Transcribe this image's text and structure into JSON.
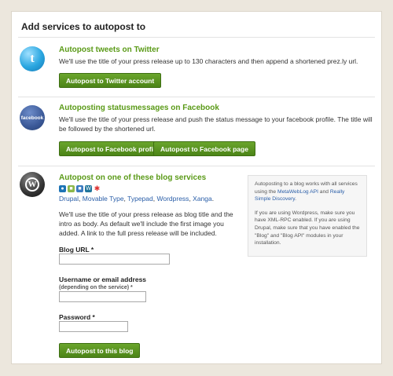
{
  "page": {
    "title": "Add services to autopost to"
  },
  "twitter": {
    "title": "Autopost tweets on Twitter",
    "description": "We'll use the title of your press release up to 130 characters and then append a shortened prez.ly url.",
    "button": "Autopost to Twitter account",
    "icon": "twitter-icon"
  },
  "facebook": {
    "title": "Autoposting statusmessages on Facebook",
    "description": "We'll use the title of your press release and push the status message to your facebook profile. The title will be followed by the shortened url.",
    "icon_text": "facebook",
    "button_profile": "Autopost to Facebook profile",
    "button_page": "Autopost to Facebook page"
  },
  "blog": {
    "title": "Autopost on one of these blog services",
    "icon": "wordpress-icon",
    "services": [
      "Drupal",
      "Movable Type",
      "Typepad",
      "Wordpress",
      "Xanga"
    ],
    "sep": ", ",
    "end": ".",
    "description": "We'll use the title of your press release as blog title and the intro as body. As default we'll include the first image you added. A link to the full press release will be included.",
    "url_label": "Blog URL *",
    "username_label": "Username or email address",
    "username_hint": "(depending on the service) *",
    "password_label": "Password *",
    "url_value": "",
    "username_value": "",
    "password_value": "",
    "button": "Autopost to this blog"
  },
  "info": {
    "p1_a": "Autoposting to a blog works with all services using the ",
    "p1_link1": "MetaWebLog API",
    "p1_and": " and ",
    "p1_link2": "Really Simple Discovery",
    "p1_end": ".",
    "p2": "If you are using Wordpress, make sure you have XML-RPC enabled. If you are using Drupal, make sure that you have enabled the \"Blog\" and \"Blog API\" modules in your installation."
  },
  "colors": {
    "accent_green": "#5a9a17",
    "button_green": "#4c8417",
    "link_blue": "#2a5ea8",
    "twitter_blue": "#2aa6e0",
    "facebook_blue": "#3b5998",
    "wordpress_dark": "#333333"
  }
}
